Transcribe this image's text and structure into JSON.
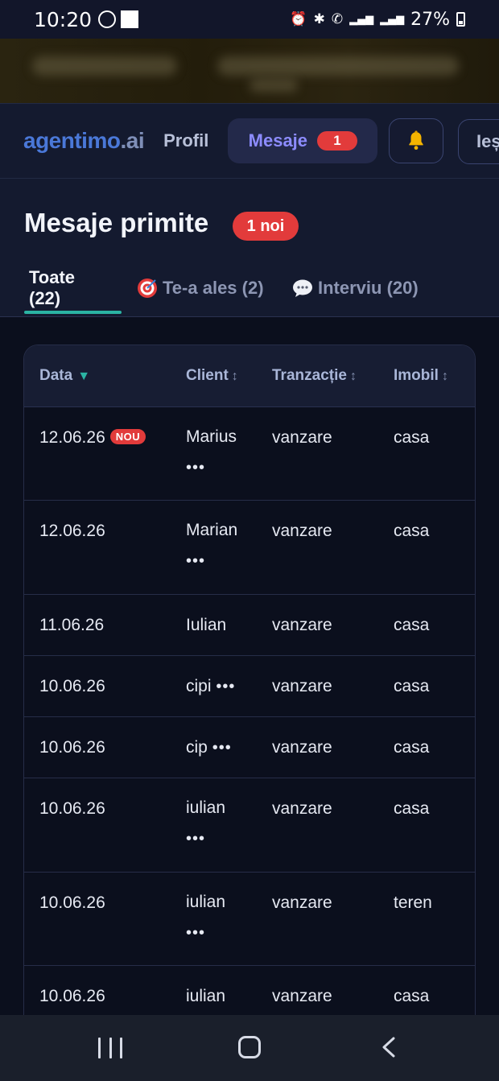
{
  "status_bar": {
    "time": "10:20",
    "battery": "27%",
    "icons": [
      "whatsapp-icon",
      "notification-square-icon",
      "alarm-icon",
      "bluetooth-icon",
      "wifi-call-icon",
      "4g-icon",
      "signal-icon",
      "call-2-icon",
      "signal-2-icon",
      "battery-icon"
    ]
  },
  "header": {
    "logo_part1": "agentimo",
    "logo_part2": ".ai",
    "nav_profil": "Profil",
    "nav_mesaje": "Mesaje",
    "mesaje_count": "1",
    "bell_icon": "bell-icon",
    "nav_iesi": "Ieși"
  },
  "page": {
    "title": "Mesaje primite",
    "new_badge": "1 noi"
  },
  "tabs": [
    {
      "label": "Toate (22)",
      "active": true
    },
    {
      "label": "Te-a ales (2)",
      "icon": "target-icon"
    },
    {
      "label": "Interviu (20)",
      "icon": "speech-bubble-icon"
    }
  ],
  "table": {
    "columns": [
      "Data",
      "Client",
      "Tranzacție",
      "Imobil"
    ],
    "sort_indicator_active": "▼",
    "sort_indicator_inactive": "↕",
    "new_label": "NOU",
    "more": "•••",
    "rows": [
      {
        "data": "12.06.26",
        "client": "Marius",
        "tranzactie": "vanzare",
        "imobil": "casa",
        "is_new": true,
        "has_more": true
      },
      {
        "data": "12.06.26",
        "client": "Marian",
        "tranzactie": "vanzare",
        "imobil": "casa",
        "has_more": true
      },
      {
        "data": "11.06.26",
        "client": "Iulian",
        "tranzactie": "vanzare",
        "imobil": "casa"
      },
      {
        "data": "10.06.26",
        "client": "cipi",
        "tranzactie": "vanzare",
        "imobil": "casa",
        "inline_more": true
      },
      {
        "data": "10.06.26",
        "client": "cip",
        "tranzactie": "vanzare",
        "imobil": "casa",
        "inline_more": true
      },
      {
        "data": "10.06.26",
        "client": "iulian",
        "tranzactie": "vanzare",
        "imobil": "casa",
        "has_more": true
      },
      {
        "data": "10.06.26",
        "client": "iulian",
        "tranzactie": "vanzare",
        "imobil": "teren",
        "has_more": true
      },
      {
        "data": "10.06.26",
        "client": "iulian",
        "tranzactie": "vanzare",
        "imobil": "casa"
      }
    ]
  },
  "colors": {
    "accent_teal": "#2bb3a3",
    "badge_red": "#e23b3b",
    "mesaje_purple": "#8d8cff",
    "logo_blue": "#4a78d8"
  }
}
